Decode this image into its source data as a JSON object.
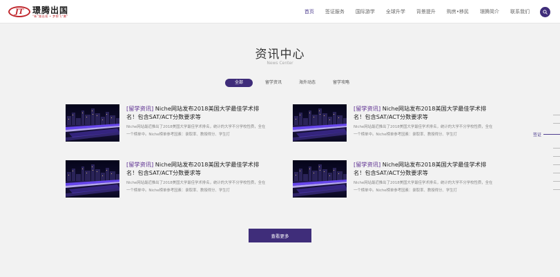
{
  "header": {
    "logo_mark": "JT",
    "logo_name": "璟腾出国",
    "logo_slogan": "\"新\"路出境 • 梦想飞\"腾\"",
    "nav": [
      "首页",
      "签证服务",
      "国际游学",
      "全球升学",
      "背景提升",
      "购房•移民",
      "璟腾简介",
      "联系我们"
    ],
    "active_nav_index": 0,
    "search_icon": "search-icon"
  },
  "section": {
    "title": "资讯中心",
    "subtitle": "News Center"
  },
  "tabs": [
    "全部",
    "留学资讯",
    "海外动态",
    "留学攻略"
  ],
  "active_tab_index": 0,
  "news": [
    {
      "tag": "[留学资讯]",
      "title": " Niche网站发布2018美国大学最佳学术排名！包含SAT/ACT分数要求等",
      "desc": "Niche网站最近推出了2018美国大学最佳学术排名，统计的大学不分学校性质，全在一个榜单中。Niche榜单参考因素：录取率、教授得分、学生打"
    },
    {
      "tag": "[留学资讯]",
      "title": " Niche网站发布2018美国大学最佳学术排名！包含SAT/ACT分数要求等",
      "desc": "Niche网站最近推出了2018美国大学最佳学术排名，统计的大学不分学校性质，全在一个榜单中。Niche榜单参考因素：录取率、教授得分、学生打"
    },
    {
      "tag": "[留学资讯]",
      "title": " Niche网站发布2018美国大学最佳学术排名！包含SAT/ACT分数要求等",
      "desc": "Niche网站最近推出了2018美国大学最佳学术排名，统计的大学不分学校性质，全在一个榜单中。Niche榜单参考因素：录取率、教授得分、学生打"
    },
    {
      "tag": "[留学资讯]",
      "title": " Niche网站发布2018美国大学最佳学术排名！包含SAT/ACT分数要求等",
      "desc": "Niche网站最近推出了2018美国大学最佳学术排名，统计的大学不分学校性质，全在一个榜单中。Niche榜单参考因素：录取率、教授得分、学生打"
    }
  ],
  "more_button": "查看更多",
  "side_nav": {
    "active_label": "签证"
  },
  "colors": {
    "accent": "#3f2d7a",
    "tag": "#5a2c8f",
    "logo_red": "#c0272d"
  }
}
